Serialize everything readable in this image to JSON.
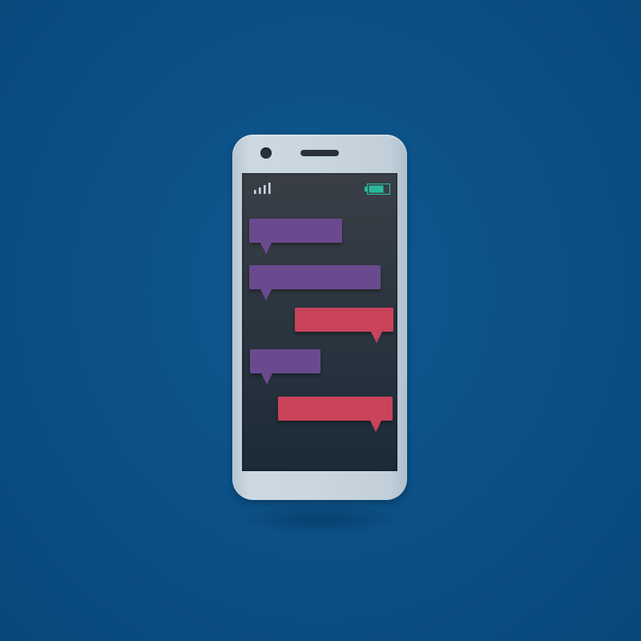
{
  "colors": {
    "background": "#0b4f85",
    "phone_body": "#c9d5df",
    "screen": "#2c3640",
    "incoming_bubble": "#6a4a8e",
    "outgoing_bubble": "#c9435a",
    "battery": "#2bb89a",
    "signal": "#c9d5df"
  },
  "status_bar": {
    "signal_icon": "signal-bars-icon",
    "signal_bars": 4,
    "battery_icon": "battery-icon",
    "battery_level": 0.75
  },
  "messages": [
    {
      "side": "left",
      "kind": "incoming"
    },
    {
      "side": "left",
      "kind": "incoming"
    },
    {
      "side": "right",
      "kind": "outgoing"
    },
    {
      "side": "left",
      "kind": "incoming"
    },
    {
      "side": "right",
      "kind": "outgoing"
    }
  ]
}
